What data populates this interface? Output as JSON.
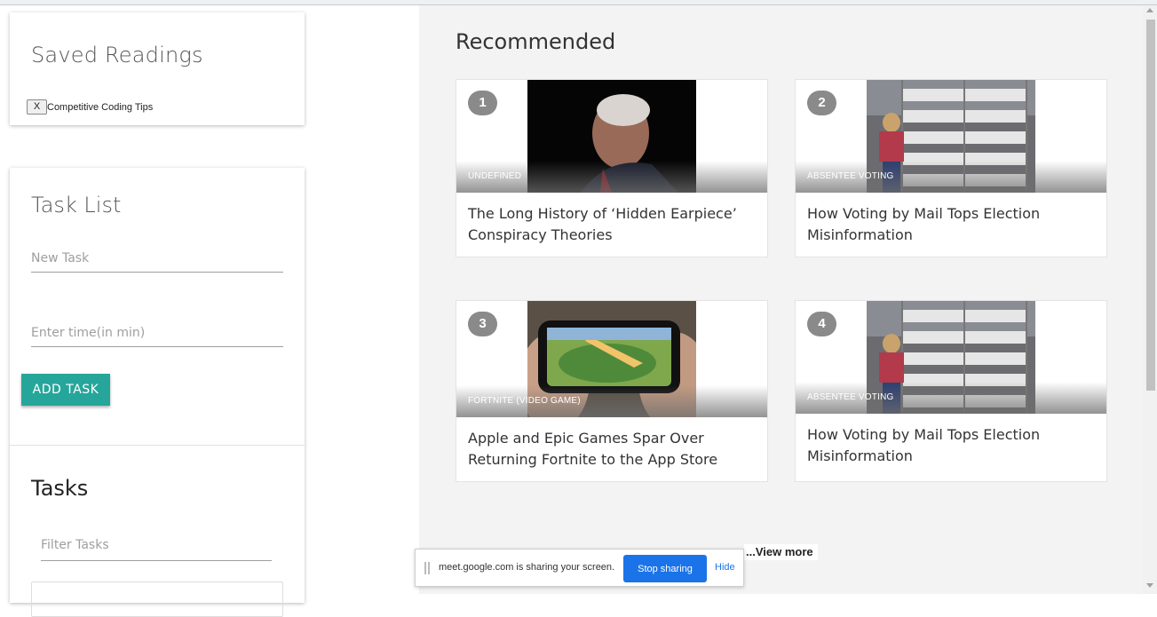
{
  "saved_readings": {
    "title": "Saved Readings",
    "items": [
      {
        "remove_label": "X",
        "label": "Competitive Coding Tips"
      }
    ]
  },
  "task_list": {
    "title": "Task List",
    "new_task_placeholder": "New Task",
    "time_placeholder": "Enter time(in min)",
    "add_button": "ADD TASK"
  },
  "tasks": {
    "title": "Tasks",
    "filter_placeholder": "Filter Tasks"
  },
  "recommended": {
    "title": "Recommended",
    "articles": [
      {
        "rank": "1",
        "tag": "undefined",
        "headline": "The Long History of ‘Hidden Earpiece’ Conspiracy Theories",
        "image": "portrait-dark-photo"
      },
      {
        "rank": "2",
        "tag": "Absentee Voting",
        "headline": "How Voting by Mail Tops Election Misinformation",
        "image": "mail-ballots-shelves-photo"
      },
      {
        "rank": "3",
        "tag": "Fortnite (Video Game)",
        "headline": "Apple and Epic Games Spar Over Returning Fortnite to the App Store",
        "image": "phone-game-photo"
      },
      {
        "rank": "4",
        "tag": "Absentee Voting",
        "headline": "How Voting by Mail Tops Election Misinformation",
        "image": "mail-ballots-shelves-photo"
      }
    ],
    "view_more": "...View more"
  },
  "share_bar": {
    "message": "meet.google.com is sharing your screen.",
    "stop_label": "Stop sharing",
    "hide_label": "Hide"
  },
  "colors": {
    "accent": "#26a69a",
    "share_button": "#1a73e8",
    "badge": "#8a8a8a"
  }
}
